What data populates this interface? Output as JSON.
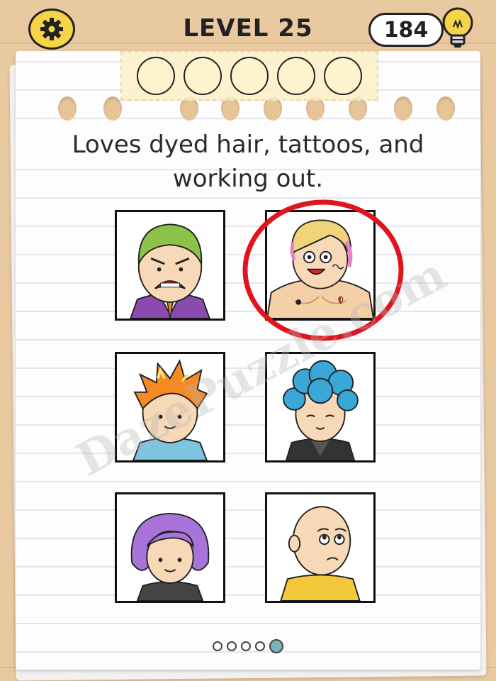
{
  "header": {
    "level_label": "LEVEL 25",
    "hint_count": "184"
  },
  "question": {
    "line1": "Loves dyed hair, tattoos, and",
    "line2": "working out."
  },
  "answer_slots": [
    "",
    "",
    "",
    "",
    ""
  ],
  "options": [
    {
      "id": "angry-green-hair-man",
      "selected": false
    },
    {
      "id": "muscular-tattooed-blonde-man",
      "selected": true
    },
    {
      "id": "orange-spiky-hair-boy",
      "selected": false
    },
    {
      "id": "blue-curly-hair-man",
      "selected": false
    },
    {
      "id": "purple-hair-woman",
      "selected": false
    },
    {
      "id": "bald-worried-man",
      "selected": false
    }
  ],
  "watermark": "DazePuzzle.com",
  "pagination": {
    "total": 5,
    "current": 5
  },
  "colors": {
    "accent_yellow": "#f6d449",
    "answer_circle": "#e0141c",
    "active_dot": "#7ab4bf",
    "background_wood": "#e9c9a0"
  },
  "icons": {
    "settings": "gear-icon",
    "hint": "lightbulb-icon"
  }
}
